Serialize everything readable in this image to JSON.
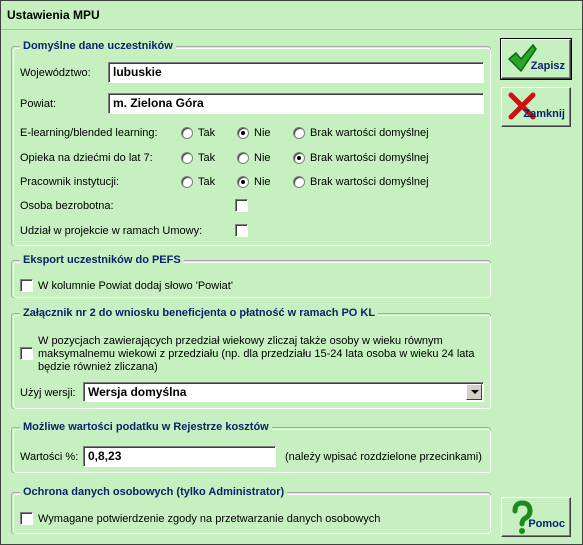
{
  "window": {
    "title": "Ustawienia MPU"
  },
  "participants": {
    "legend": "Domyślne dane uczestników",
    "voivodeship_label": "Województwo:",
    "voivodeship_value": "lubuskie",
    "county_label": "Powiat:",
    "county_value": "m. Zielona Góra",
    "options": {
      "yes": "Tak",
      "no": "Nie",
      "none": "Brak wartości domyślnej"
    },
    "elearning_label": "E-learning/blended learning:",
    "elearning_selected": "Nie",
    "childcare_label": "Opieka na dziećmi do lat 7:",
    "childcare_selected": "Brak wartości domyślnej",
    "employee_label": "Pracownik instytucji:",
    "employee_selected": "Nie",
    "unemployed_label": "Osoba bezrobotna:",
    "unemployed_checked": false,
    "participation_label": "Udział w projekcie w ramach Umowy:",
    "participation_checked": false
  },
  "pefs": {
    "legend": "Eksport uczestników do PEFS",
    "county_word_label": "W kolumnie Powiat dodaj słowo 'Powiat'",
    "county_word_checked": false
  },
  "attachment": {
    "legend": "Załącznik nr 2 do wniosku beneficjenta o płatność w ramach PO KL",
    "age_line1": "W pozycjach zawierających przedział wiekowy zliczaj także osoby w wieku równym",
    "age_line2": "maksymalnemu wiekowi z przedziału (np. dla przedziału 15-24 lata osoba w wieku 24 lata",
    "age_line3": "będzie również zliczana)",
    "age_checked": false,
    "version_label": "Użyj wersji:",
    "version_value": "Wersja domyślna"
  },
  "tax": {
    "legend": "Możliwe wartości podatku w Rejestrze kosztów",
    "values_label": "Wartości %:",
    "values_value": "0,8,23",
    "hint": "(należy wpisać rozdzielone przecinkami)"
  },
  "privacy": {
    "legend": "Ochrona danych osobowych (tylko Administrator)",
    "consent_label": "Wymagane potwierdzenie zgody na przetwarzanie danych osobowych",
    "consent_checked": false
  },
  "buttons": {
    "save": "Zapisz",
    "close": "Zamknij",
    "help": "Pomoc"
  },
  "icons": {
    "save": "check-icon",
    "close": "x-icon",
    "help": "question-icon"
  }
}
